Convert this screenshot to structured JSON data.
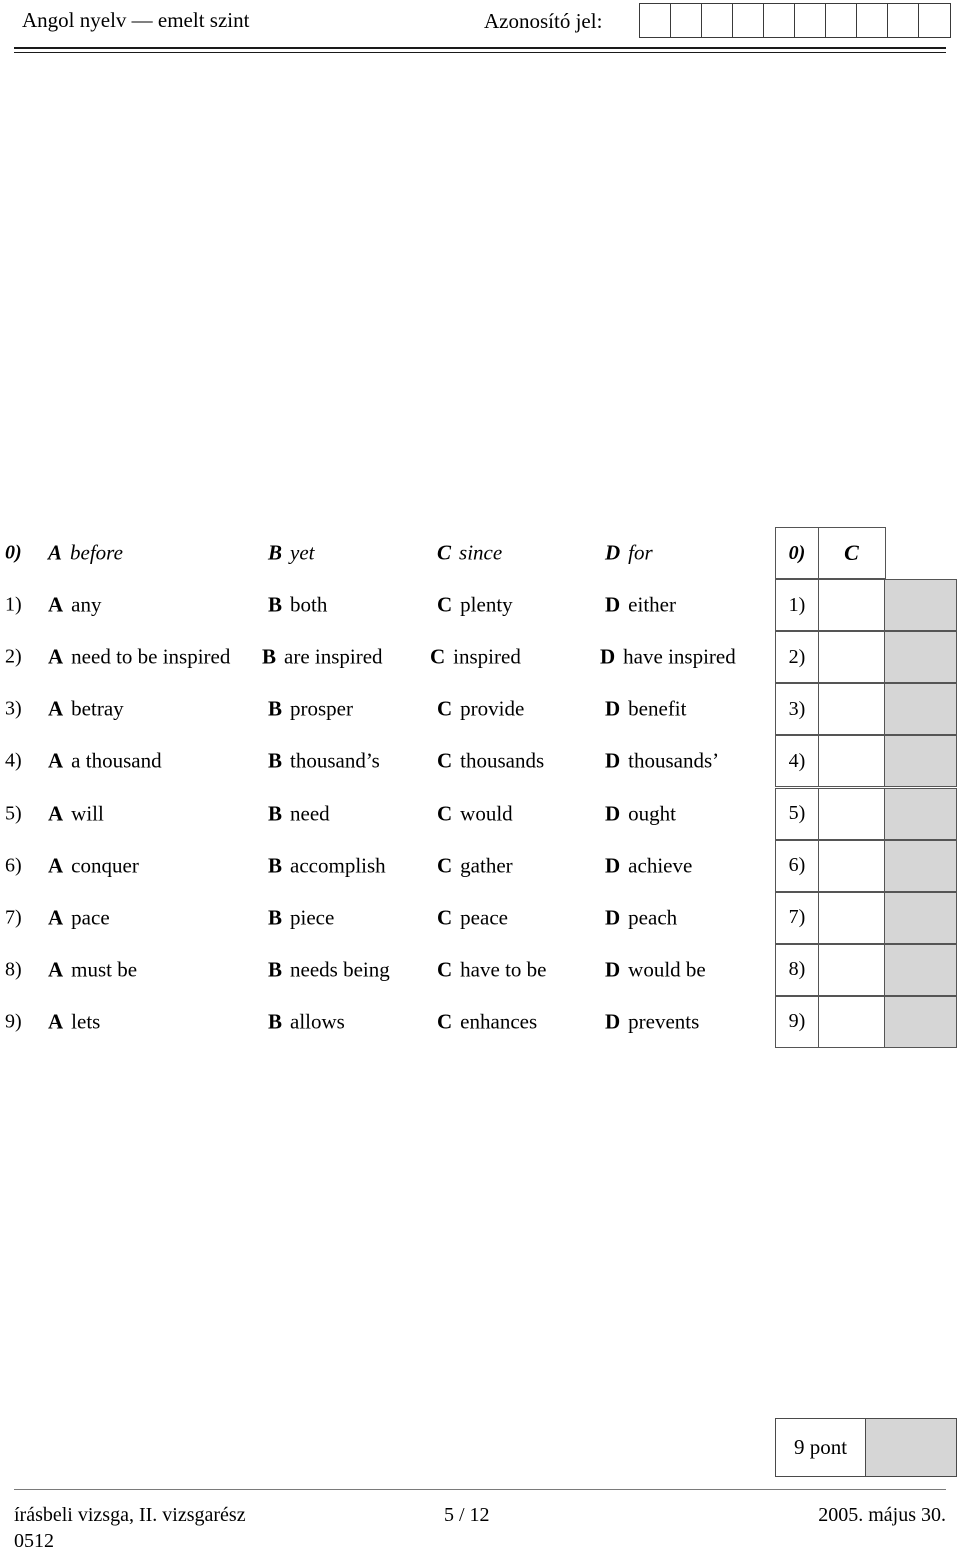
{
  "header": {
    "subject": "Angol nyelv — emelt szint",
    "id_label": "Azonosító jel:",
    "id_box_count": 10
  },
  "colors": {
    "grey_cell": "#d6d6d6",
    "rule": "#1a1a1a",
    "table_border": "#555555"
  },
  "questions": [
    {
      "number": "0)",
      "is_example": true,
      "options": [
        {
          "letter": "A",
          "text": "before"
        },
        {
          "letter": "B",
          "text": "yet"
        },
        {
          "letter": "C",
          "text": "since"
        },
        {
          "letter": "D",
          "text": "for"
        }
      ],
      "answer": "C"
    },
    {
      "number": "1)",
      "is_example": false,
      "options": [
        {
          "letter": "A",
          "text": "any"
        },
        {
          "letter": "B",
          "text": "both"
        },
        {
          "letter": "C",
          "text": "plenty"
        },
        {
          "letter": "D",
          "text": "either"
        }
      ],
      "answer": ""
    },
    {
      "number": "2)",
      "is_example": false,
      "options": [
        {
          "letter": "A",
          "text": "need to be inspired"
        },
        {
          "letter": "B",
          "text": "are inspired"
        },
        {
          "letter": "C",
          "text": "inspired"
        },
        {
          "letter": "D",
          "text": "have inspired"
        }
      ],
      "answer": ""
    },
    {
      "number": "3)",
      "is_example": false,
      "options": [
        {
          "letter": "A",
          "text": "betray"
        },
        {
          "letter": "B",
          "text": "prosper"
        },
        {
          "letter": "C",
          "text": "provide"
        },
        {
          "letter": "D",
          "text": "benefit"
        }
      ],
      "answer": ""
    },
    {
      "number": "4)",
      "is_example": false,
      "options": [
        {
          "letter": "A",
          "text": "a thousand"
        },
        {
          "letter": "B",
          "text": "thousand’s"
        },
        {
          "letter": "C",
          "text": "thousands"
        },
        {
          "letter": "D",
          "text": "thousands’"
        }
      ],
      "answer": ""
    },
    {
      "number": "5)",
      "is_example": false,
      "options": [
        {
          "letter": "A",
          "text": "will"
        },
        {
          "letter": "B",
          "text": "need"
        },
        {
          "letter": "C",
          "text": "would"
        },
        {
          "letter": "D",
          "text": "ought"
        }
      ],
      "answer": ""
    },
    {
      "number": "6)",
      "is_example": false,
      "options": [
        {
          "letter": "A",
          "text": "conquer"
        },
        {
          "letter": "B",
          "text": "accomplish"
        },
        {
          "letter": "C",
          "text": "gather"
        },
        {
          "letter": "D",
          "text": "achieve"
        }
      ],
      "answer": ""
    },
    {
      "number": "7)",
      "is_example": false,
      "options": [
        {
          "letter": "A",
          "text": "pace"
        },
        {
          "letter": "B",
          "text": "piece"
        },
        {
          "letter": "C",
          "text": "peace"
        },
        {
          "letter": "D",
          "text": "peach"
        }
      ],
      "answer": ""
    },
    {
      "number": "8)",
      "is_example": false,
      "options": [
        {
          "letter": "A",
          "text": "must be"
        },
        {
          "letter": "B",
          "text": "needs being"
        },
        {
          "letter": "C",
          "text": "have to be"
        },
        {
          "letter": "D",
          "text": "would be"
        }
      ],
      "answer": ""
    },
    {
      "number": "9)",
      "is_example": false,
      "options": [
        {
          "letter": "A",
          "text": "lets"
        },
        {
          "letter": "B",
          "text": "allows"
        },
        {
          "letter": "C",
          "text": "enhances"
        },
        {
          "letter": "D",
          "text": "prevents"
        }
      ],
      "answer": ""
    }
  ],
  "points": {
    "label": "9 pont"
  },
  "footer": {
    "left": "írásbeli vizsga, II. vizsgarész",
    "code": "0512",
    "page": "5 / 12",
    "date": "2005. május 30."
  }
}
